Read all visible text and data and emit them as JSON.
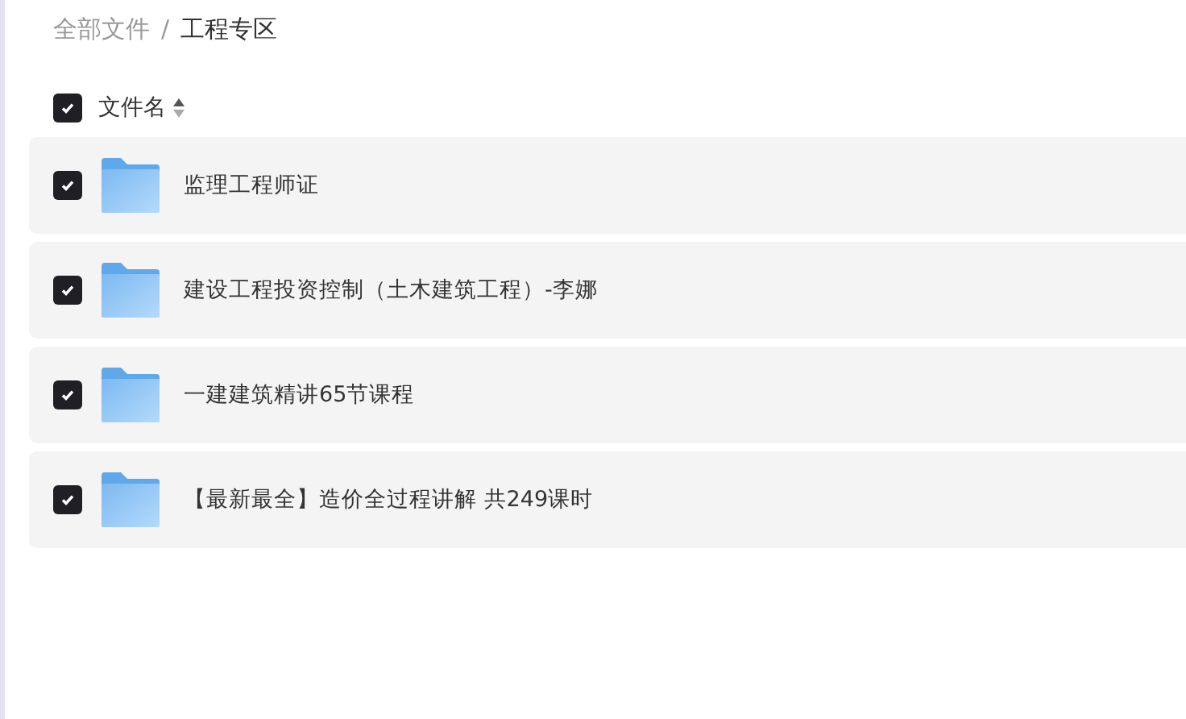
{
  "breadcrumb": [
    {
      "label": "全部文件",
      "current": false
    },
    {
      "label": "工程专区",
      "current": true
    }
  ],
  "breadcrumb_separator": "/",
  "header": {
    "checked": true,
    "label": "文件名"
  },
  "files": [
    {
      "name": "监理工程师证",
      "checked": true
    },
    {
      "name": "建设工程投资控制（土木建筑工程）-李娜",
      "checked": true
    },
    {
      "name": "一建建筑精讲65节课程",
      "checked": true
    },
    {
      "name": "【最新最全】造价全过程讲解 共249课时",
      "checked": true
    }
  ]
}
